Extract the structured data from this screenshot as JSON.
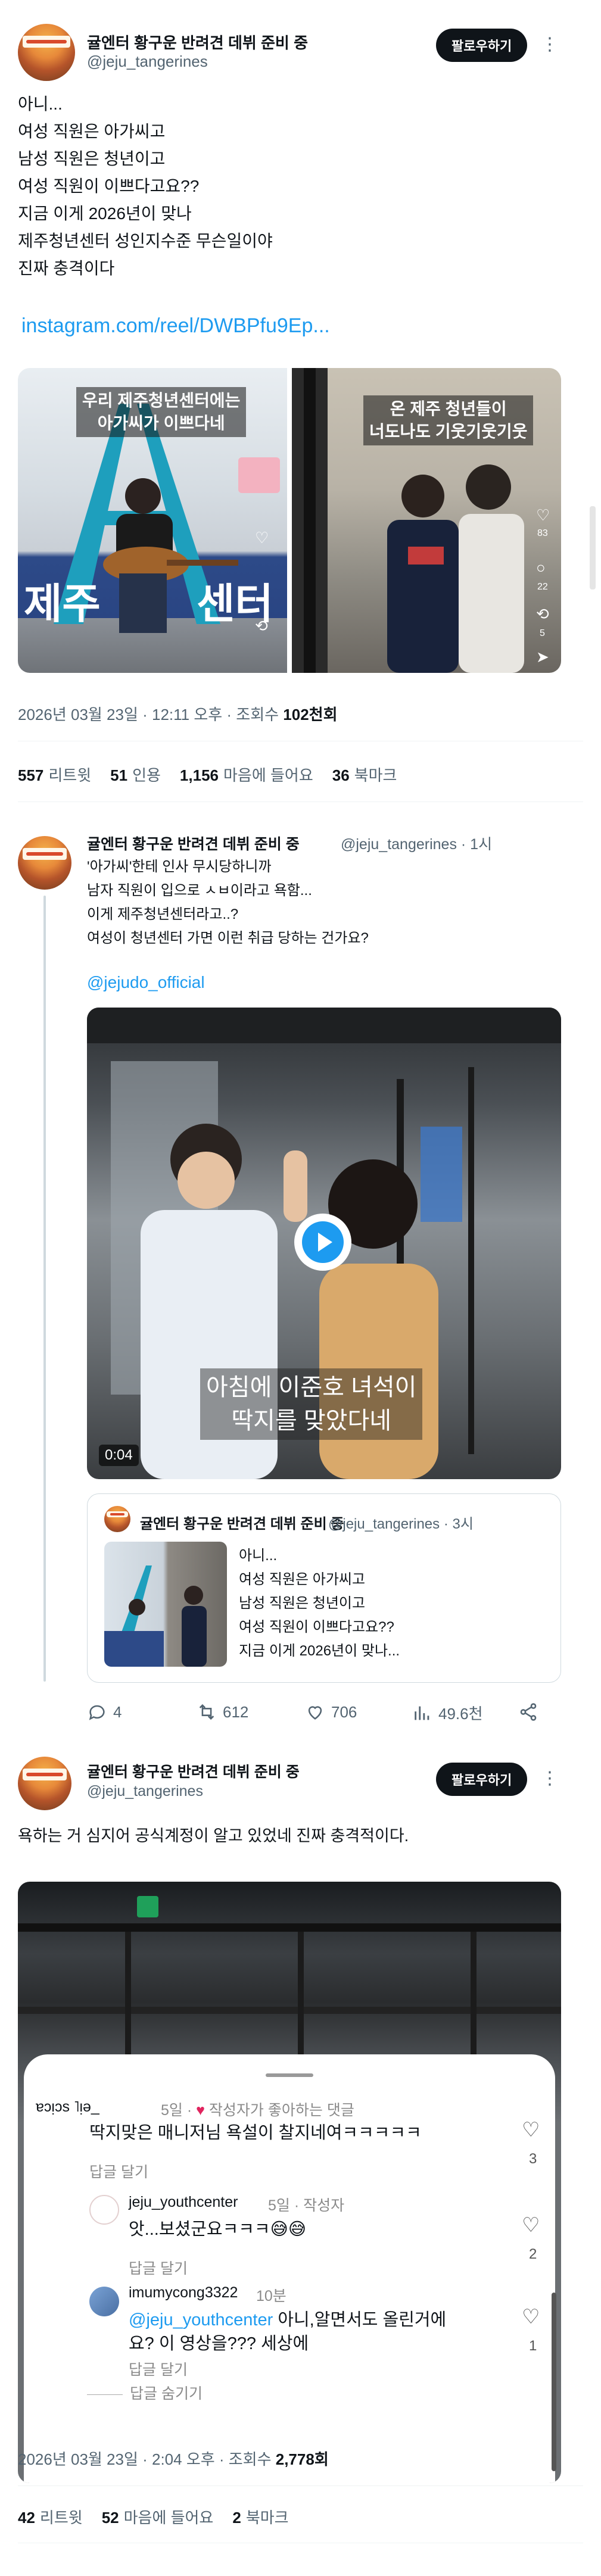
{
  "main_post": {
    "author_name": "귤엔터 황구운 반려견 데뷔 준비 중",
    "handle": "@jeju_tangerines",
    "follow_label": "팔로우하기",
    "more": "⋮",
    "text": "아니...\n여성 직원은 아가씨고\n남성 직원은 청년이고\n여성 직원이 이쁘다고요??\n지금 이게 2026년이 맞나\n제주청년센터 성인지수준 무슨일이야\n진짜 충격이다",
    "link": "instagram.com/reel/DWBPfu9Ep...",
    "left_caption": "우리 제주청년센터에는\n아가씨가 이쁘다네",
    "right_caption": "온 제주 청년들이\n너도나도 기웃기웃기웃",
    "date_time": "2026년 03월 23일 · 12:11 오후 · 조회수 ",
    "views": "102천회",
    "reposts_count": "557",
    "reposts_label": "리트윗",
    "quotes_count": "51",
    "quotes_label": "인용",
    "likes_count": "1,156",
    "likes_label": "마음에 들어요",
    "bookmarks_count": "36",
    "bookmarks_label": "북마크",
    "side_counts": [
      "83",
      "22",
      "5"
    ]
  },
  "reply_post": {
    "author_name": "귤엔터 황구운 반려견 데뷔 준비 중",
    "handle_time": "@jeju_tangerines · 1시",
    "text": "'아가씨'한테 인사 무시당하니까\n남자 직원이 입으로 ㅅㅂ이라고 욕함...\n이게 제주청년센터라고..?\n여성이 청년센터 가면 이런 취급 당하는 건가요?",
    "mention": "@jejudo_official",
    "video_caption": "아침에 이준호 녀석이\n딱지를 맞았다네",
    "video_duration": "0:04",
    "quote": {
      "author_name": "귤엔터 황구운 반려견 데뷔 준비 중",
      "handle_time": "@jeju_tangerines · 3시",
      "text": "아니...\n여성 직원은 아가씨고\n남성 직원은 청년이고\n여성 직원이 이쁘다고요??\n지금 이게 2026년이 맞나..."
    },
    "actions": {
      "replies": "4",
      "reposts": "612",
      "likes": "706",
      "views": "49.6천"
    }
  },
  "third_post": {
    "author_name": "귤엔터 황구운 반려견 데뷔 준비 중",
    "handle": "@jeju_tangerines",
    "follow_label": "팔로우하기",
    "text": "욕하는 거 심지어 공식계정이 알고 있었네 진짜 충격적이다.",
    "comments": [
      {
        "name": "ɐɔᴉɔs ˥ᴉǝ_",
        "meta": "5일 · ",
        "liked_by_author": "작성자가 좋아하는 댓글",
        "text": "딱지맞은 매니저님 욕설이 찰지네여ㅋㅋㅋㅋㅋ",
        "reply": "답글 달기",
        "likes": "3"
      },
      {
        "name": "jeju_youthcenter",
        "meta": "5일 · 작성자",
        "text": "앗...보셨군요ㅋㅋㅋ😅😅",
        "reply": "답글 달기",
        "likes": "2"
      },
      {
        "name": "imumycong3322",
        "meta": "10분",
        "mention": "@jeju_youthcenter",
        "text": " 아니,알면서도 올린거에\n요? 이 영상을??? 세상에",
        "reply": "답글 달기",
        "hide": "답글 숨기기",
        "likes": "1"
      }
    ],
    "date_time": "2026년 03월 23일 · 2:04 오후 · 조회수 ",
    "views": "2,778회",
    "reposts_count": "42",
    "reposts_label": "리트윗",
    "likes_count": "52",
    "likes_label": "마음에 들어요",
    "bookmarks_count": "2",
    "bookmarks_label": "북마크"
  }
}
